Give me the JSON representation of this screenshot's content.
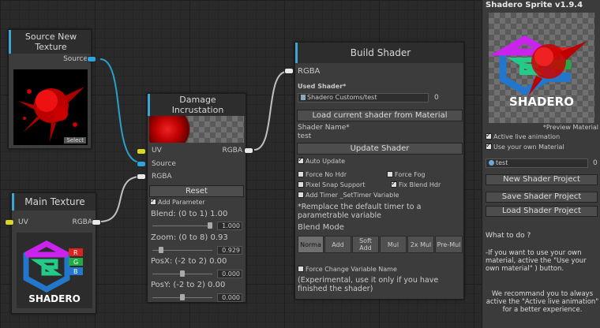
{
  "source_node": {
    "title": "Source New Texture",
    "port_label": "Source",
    "select_label": "Select"
  },
  "main_texture_node": {
    "title": "Main Texture",
    "uv_label": "UV",
    "rgba_label": "RGBA"
  },
  "damage_node": {
    "title": "Damage Incrustation",
    "uv_label": "UV",
    "rgba_out_label": "RGBA",
    "source_label": "Source",
    "rgba_in_label": "RGBA",
    "reset_label": "Reset",
    "add_parameter_label": "Add Parameter",
    "blend_label": "Blend: (0 to 1) 1.00",
    "blend_value": "1.000",
    "zoom_label": "Zoom: (0 to 8) 0.93",
    "zoom_value": "0.929",
    "posx_label": "PosX: (-2 to 2) 0.00",
    "posx_value": "0.000",
    "posy_label": "PosY: (-2 to 2) 0.00",
    "posy_value": "0.000"
  },
  "build_shader_node": {
    "title": "Build Shader",
    "rgba_label": "RGBA",
    "used_shader_label": "Used Shader*",
    "used_shader_value": "Shadero Customs/test",
    "used_shader_count": "0",
    "load_button": "Load current shader from Material",
    "shader_name_label": "Shader Name*",
    "shader_name_value": "test",
    "update_button": "Update Shader",
    "auto_update": "Auto Update",
    "force_no_hdr": "Force No Hdr",
    "force_fog": "Force Fog",
    "pixel_snap": "Pixel Snap Support",
    "fix_blend_hdr": "Fix Blend Hdr",
    "add_timer": "Add Timer _SetTimer Variable",
    "replace_note": "*Remplace the default timer to a parametrable variable",
    "blend_mode_label": "Blend Mode",
    "blend_modes": [
      "Norma",
      "Add",
      "Soft Add",
      "Mul",
      "2x Mul",
      "Pre-Mul"
    ],
    "force_change_var": "Force Change Variable Name",
    "experimental_note": "(Experimental, use it only if you have finished the shader)"
  },
  "right_panel": {
    "title": "Shadero Sprite v1.9.4",
    "preview_label": "*Preview Material",
    "logo_text": "SHADERO",
    "active_live": "Active live animation",
    "use_own_material": "Use your own Material",
    "material_field": "test",
    "material_count": "0",
    "new_shader_button": "New Shader Project",
    "save_shader_button": "Save Shader Project",
    "load_shader_button": "Load Shader Project",
    "help_title": "What to do ?",
    "help_text_1": "-If you want to use your own material, active the \"Use your own material\" ) button.",
    "help_text_2": "We recommand you to always active the \"Active live animation\" for a better experience."
  },
  "logo": {
    "letters": [
      "R",
      "G",
      "B"
    ],
    "text": "SHADERO"
  },
  "colors": {
    "accent": "#3aa7d8",
    "port_blue": "#2fa3dc",
    "port_yellow": "#d8d820",
    "wire": "#c0c0c0"
  }
}
